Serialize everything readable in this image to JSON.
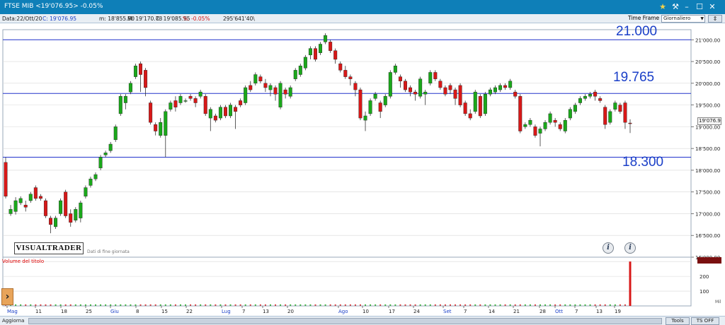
{
  "window": {
    "title": "FTSE MIB <19'076.95> -0.05%"
  },
  "info_bar": {
    "data": "Data:22/Ott/20",
    "close": "C: 19'076.95",
    "min": "m: 18'855.90",
    "max": "M: 19'170.73",
    "open": "O: 19'085.95",
    "pct": "%: -0.05%",
    "volume": "295'641'40\\"
  },
  "time_frame": {
    "label": "Time Frame",
    "value": "Giornaliero"
  },
  "levels": {
    "upper": "21.000",
    "middle": "19.765",
    "lower": "18.300"
  },
  "logo": {
    "name": "VISUALTRADER",
    "subtitle": "Dati di fine giornata"
  },
  "volume_panel": {
    "label": "Volume del titolo",
    "unit": "Mil",
    "axis_ticks": [
      "300",
      "200",
      "100"
    ]
  },
  "price_tag": "19'076.9",
  "bottom_bar": {
    "update": "Aggiorna",
    "tools": "Tools",
    "ts": "TS OFF"
  },
  "colors": {
    "up": "#1aa81a",
    "down": "#d81818",
    "level_line": "#2233cc",
    "level_text": "#1a3fc8",
    "grid": "#d8d8d8"
  },
  "chart_data": {
    "type": "candlestick",
    "title": "FTSE MIB",
    "ylim": [
      16000,
      21200
    ],
    "yticks": [
      "21'000.00",
      "20'500.00",
      "20'000.00",
      "19'500.00",
      "19'000.00",
      "18'500.00",
      "18'000.00",
      "17'500.00",
      "17'000.00",
      "16'500.00",
      "16'000.00"
    ],
    "xticks": [
      "Mag",
      "11",
      "18",
      "25",
      "Giu",
      "8",
      "15",
      "22",
      "Lug",
      "7",
      "13",
      "20",
      "Ago",
      "10",
      "17",
      "24",
      "Set",
      "7",
      "14",
      "21",
      "28",
      "Ott",
      "7",
      "13",
      "19"
    ],
    "horizontal_levels": [
      21000,
      19765,
      18300
    ],
    "candles": [
      {
        "o": 18180,
        "c": 17400,
        "h": 18300,
        "l": 17350
      },
      {
        "o": 17000,
        "c": 17100,
        "h": 17200,
        "l": 16950
      },
      {
        "o": 17050,
        "c": 17300,
        "h": 17380,
        "l": 16980
      },
      {
        "o": 17250,
        "c": 17350,
        "h": 17400,
        "l": 17200
      },
      {
        "o": 17200,
        "c": 17150,
        "h": 17300,
        "l": 17050
      },
      {
        "o": 17300,
        "c": 17450,
        "h": 17500,
        "l": 17250
      },
      {
        "o": 17600,
        "c": 17350,
        "h": 17650,
        "l": 17300
      },
      {
        "o": 17400,
        "c": 17350,
        "h": 17450,
        "l": 17300
      },
      {
        "o": 17300,
        "c": 16950,
        "h": 17350,
        "l": 16900
      },
      {
        "o": 16900,
        "c": 16750,
        "h": 16950,
        "l": 16550
      },
      {
        "o": 16700,
        "c": 16900,
        "h": 16950,
        "l": 16650
      },
      {
        "o": 17000,
        "c": 17300,
        "h": 17350,
        "l": 16950
      },
      {
        "o": 17500,
        "c": 16950,
        "h": 17550,
        "l": 16900
      },
      {
        "o": 17000,
        "c": 16800,
        "h": 17100,
        "l": 16700
      },
      {
        "o": 16850,
        "c": 17100,
        "h": 17150,
        "l": 16800
      },
      {
        "o": 16900,
        "c": 17250,
        "h": 17300,
        "l": 16800
      },
      {
        "o": 17400,
        "c": 17600,
        "h": 17650,
        "l": 17350
      },
      {
        "o": 17650,
        "c": 17800,
        "h": 17850,
        "l": 17600
      },
      {
        "o": 17800,
        "c": 17900,
        "h": 17950,
        "l": 17750
      },
      {
        "o": 18050,
        "c": 18300,
        "h": 18350,
        "l": 18000
      },
      {
        "o": 18350,
        "c": 18400,
        "h": 18450,
        "l": 18300
      },
      {
        "o": 18450,
        "c": 18600,
        "h": 18650,
        "l": 18400
      },
      {
        "o": 18700,
        "c": 19000,
        "h": 19050,
        "l": 18650
      },
      {
        "o": 19300,
        "c": 19700,
        "h": 19750,
        "l": 19250
      },
      {
        "o": 19550,
        "c": 19700,
        "h": 19750,
        "l": 19400
      },
      {
        "o": 19800,
        "c": 20000,
        "h": 20050,
        "l": 19750
      },
      {
        "o": 20150,
        "c": 20400,
        "h": 20450,
        "l": 20100
      },
      {
        "o": 20450,
        "c": 20200,
        "h": 20500,
        "l": 19800
      },
      {
        "o": 20300,
        "c": 19900,
        "h": 20350,
        "l": 19700
      },
      {
        "o": 19550,
        "c": 19100,
        "h": 19600,
        "l": 19050
      },
      {
        "o": 19050,
        "c": 18900,
        "h": 19100,
        "l": 18800
      },
      {
        "o": 18800,
        "c": 19100,
        "h": 19200,
        "l": 18750
      },
      {
        "o": 18800,
        "c": 19350,
        "h": 19400,
        "l": 18300
      },
      {
        "o": 19400,
        "c": 19550,
        "h": 19600,
        "l": 19350
      },
      {
        "o": 19600,
        "c": 19450,
        "h": 19700,
        "l": 19350
      },
      {
        "o": 19550,
        "c": 19700,
        "h": 19750,
        "l": 19500
      },
      {
        "o": 19600,
        "c": 19600,
        "h": 19650,
        "l": 19550
      },
      {
        "o": 19700,
        "c": 19650,
        "h": 19750,
        "l": 19600
      },
      {
        "o": 19650,
        "c": 19550,
        "h": 19700,
        "l": 19450
      },
      {
        "o": 19700,
        "c": 19800,
        "h": 19850,
        "l": 19650
      },
      {
        "o": 19700,
        "c": 19300,
        "h": 19750,
        "l": 19250
      },
      {
        "o": 19200,
        "c": 19400,
        "h": 19450,
        "l": 18900
      },
      {
        "o": 19250,
        "c": 19150,
        "h": 19300,
        "l": 19100
      },
      {
        "o": 19200,
        "c": 19450,
        "h": 19500,
        "l": 19150
      },
      {
        "o": 19450,
        "c": 19250,
        "h": 19500,
        "l": 19200
      },
      {
        "o": 19250,
        "c": 19500,
        "h": 19550,
        "l": 19200
      },
      {
        "o": 19450,
        "c": 19350,
        "h": 19500,
        "l": 18950
      },
      {
        "o": 19600,
        "c": 19500,
        "h": 19650,
        "l": 19450
      },
      {
        "o": 19550,
        "c": 19900,
        "h": 19950,
        "l": 19500
      },
      {
        "o": 19950,
        "c": 19850,
        "h": 20050,
        "l": 19800
      },
      {
        "o": 20000,
        "c": 20200,
        "h": 20250,
        "l": 19950
      },
      {
        "o": 20150,
        "c": 20050,
        "h": 20200,
        "l": 20000
      },
      {
        "o": 20000,
        "c": 19900,
        "h": 20100,
        "l": 19800
      },
      {
        "o": 19850,
        "c": 19950,
        "h": 20000,
        "l": 19700
      },
      {
        "o": 19900,
        "c": 19750,
        "h": 19950,
        "l": 19600
      },
      {
        "o": 19450,
        "c": 20000,
        "h": 20050,
        "l": 19400
      },
      {
        "o": 19850,
        "c": 19750,
        "h": 19900,
        "l": 19650
      },
      {
        "o": 19700,
        "c": 19900,
        "h": 19950,
        "l": 19650
      },
      {
        "o": 20100,
        "c": 20300,
        "h": 20350,
        "l": 20050
      },
      {
        "o": 20200,
        "c": 20400,
        "h": 20450,
        "l": 20150
      },
      {
        "o": 20350,
        "c": 20600,
        "h": 20650,
        "l": 20300
      },
      {
        "o": 20650,
        "c": 20800,
        "h": 20850,
        "l": 20550
      },
      {
        "o": 20800,
        "c": 20550,
        "h": 20850,
        "l": 20500
      },
      {
        "o": 20700,
        "c": 20900,
        "h": 20950,
        "l": 20650
      },
      {
        "o": 20950,
        "c": 21100,
        "h": 21150,
        "l": 20900
      },
      {
        "o": 20950,
        "c": 20750,
        "h": 21000,
        "l": 20700
      },
      {
        "o": 20750,
        "c": 20550,
        "h": 20800,
        "l": 20450
      },
      {
        "o": 20450,
        "c": 20300,
        "h": 20500,
        "l": 20250
      },
      {
        "o": 20300,
        "c": 20150,
        "h": 20400,
        "l": 20100
      },
      {
        "o": 20150,
        "c": 20100,
        "h": 20200,
        "l": 19950
      },
      {
        "o": 20000,
        "c": 19850,
        "h": 20050,
        "l": 19700
      },
      {
        "o": 19850,
        "c": 19200,
        "h": 19900,
        "l": 19150
      },
      {
        "o": 19150,
        "c": 19250,
        "h": 19350,
        "l": 18900
      },
      {
        "o": 19300,
        "c": 19600,
        "h": 19650,
        "l": 19250
      },
      {
        "o": 19650,
        "c": 19750,
        "h": 19800,
        "l": 19600
      },
      {
        "o": 19550,
        "c": 19350,
        "h": 19600,
        "l": 19200
      },
      {
        "o": 19500,
        "c": 19700,
        "h": 19750,
        "l": 19450
      },
      {
        "o": 19700,
        "c": 20250,
        "h": 20300,
        "l": 19650
      },
      {
        "o": 20250,
        "c": 20400,
        "h": 20450,
        "l": 20200
      },
      {
        "o": 20150,
        "c": 20050,
        "h": 20200,
        "l": 19900
      },
      {
        "o": 20050,
        "c": 19850,
        "h": 20100,
        "l": 19800
      },
      {
        "o": 19900,
        "c": 19800,
        "h": 19950,
        "l": 19700
      },
      {
        "o": 19800,
        "c": 19750,
        "h": 19850,
        "l": 19600
      },
      {
        "o": 19700,
        "c": 20100,
        "h": 20150,
        "l": 19650
      },
      {
        "o": 19750,
        "c": 19800,
        "h": 19850,
        "l": 19500
      },
      {
        "o": 20000,
        "c": 20250,
        "h": 20300,
        "l": 19950
      },
      {
        "o": 20250,
        "c": 20100,
        "h": 20300,
        "l": 20050
      },
      {
        "o": 20050,
        "c": 19900,
        "h": 20100,
        "l": 19850
      },
      {
        "o": 19900,
        "c": 19750,
        "h": 19950,
        "l": 19700
      },
      {
        "o": 19950,
        "c": 19850,
        "h": 20000,
        "l": 19750
      },
      {
        "o": 19850,
        "c": 19650,
        "h": 19900,
        "l": 19500
      },
      {
        "o": 19950,
        "c": 19500,
        "h": 20000,
        "l": 19450
      },
      {
        "o": 19550,
        "c": 19300,
        "h": 19600,
        "l": 19250
      },
      {
        "o": 19300,
        "c": 19200,
        "h": 19400,
        "l": 19150
      },
      {
        "o": 19350,
        "c": 19800,
        "h": 19850,
        "l": 19300
      },
      {
        "o": 19700,
        "c": 19250,
        "h": 19750,
        "l": 19200
      },
      {
        "o": 19300,
        "c": 19750,
        "h": 19800,
        "l": 19250
      },
      {
        "o": 19750,
        "c": 19850,
        "h": 19900,
        "l": 19700
      },
      {
        "o": 19800,
        "c": 19900,
        "h": 19950,
        "l": 19750
      },
      {
        "o": 19850,
        "c": 19950,
        "h": 20000,
        "l": 19800
      },
      {
        "o": 19950,
        "c": 19900,
        "h": 20000,
        "l": 19850
      },
      {
        "o": 19900,
        "c": 20050,
        "h": 20100,
        "l": 19850
      },
      {
        "o": 19800,
        "c": 19700,
        "h": 19850,
        "l": 19650
      },
      {
        "o": 19700,
        "c": 18900,
        "h": 19750,
        "l": 18850
      },
      {
        "o": 19000,
        "c": 19050,
        "h": 19100,
        "l": 18950
      },
      {
        "o": 19050,
        "c": 19150,
        "h": 19200,
        "l": 19000
      },
      {
        "o": 19000,
        "c": 18800,
        "h": 19050,
        "l": 18750
      },
      {
        "o": 18850,
        "c": 18950,
        "h": 19000,
        "l": 18550
      },
      {
        "o": 18950,
        "c": 19100,
        "h": 19150,
        "l": 18900
      },
      {
        "o": 19100,
        "c": 19300,
        "h": 19350,
        "l": 19050
      },
      {
        "o": 19150,
        "c": 19100,
        "h": 19200,
        "l": 19000
      },
      {
        "o": 19050,
        "c": 18950,
        "h": 19100,
        "l": 18900
      },
      {
        "o": 18900,
        "c": 19150,
        "h": 19200,
        "l": 18850
      },
      {
        "o": 19200,
        "c": 19400,
        "h": 19450,
        "l": 19150
      },
      {
        "o": 19350,
        "c": 19500,
        "h": 19550,
        "l": 19300
      },
      {
        "o": 19550,
        "c": 19650,
        "h": 19700,
        "l": 19500
      },
      {
        "o": 19650,
        "c": 19700,
        "h": 19750,
        "l": 19600
      },
      {
        "o": 19700,
        "c": 19750,
        "h": 19800,
        "l": 19650
      },
      {
        "o": 19800,
        "c": 19700,
        "h": 19850,
        "l": 19600
      },
      {
        "o": 19650,
        "c": 19600,
        "h": 19700,
        "l": 19550
      },
      {
        "o": 19450,
        "c": 19050,
        "h": 19500,
        "l": 18950
      },
      {
        "o": 19100,
        "c": 19350,
        "h": 19400,
        "l": 19050
      },
      {
        "o": 19400,
        "c": 19550,
        "h": 19600,
        "l": 19350
      },
      {
        "o": 19500,
        "c": 19350,
        "h": 19550,
        "l": 19300
      },
      {
        "o": 19550,
        "c": 19100,
        "h": 19600,
        "l": 18950
      },
      {
        "o": 19085.95,
        "c": 19076.95,
        "h": 19170.73,
        "l": 18855.9
      }
    ],
    "volume": {
      "last_bar": 300
    }
  }
}
